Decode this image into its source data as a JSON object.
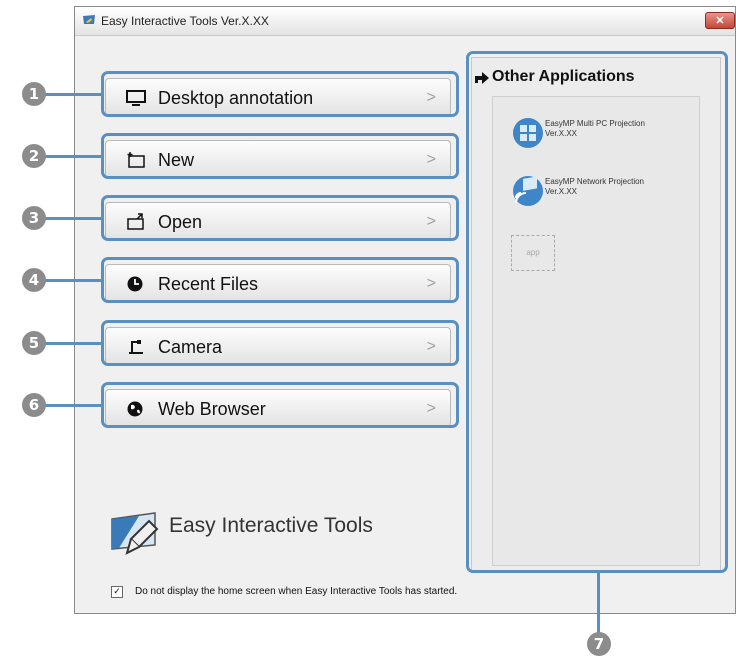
{
  "window": {
    "title": "Easy Interactive Tools Ver.X.XX",
    "close_label": "✕"
  },
  "menu": [
    {
      "label": "Desktop annotation",
      "icon": "monitor-icon"
    },
    {
      "label": "New",
      "icon": "new-whiteboard-icon"
    },
    {
      "label": "Open",
      "icon": "open-folder-icon"
    },
    {
      "label": "Recent Files",
      "icon": "recent-clock-icon"
    },
    {
      "label": "Camera",
      "icon": "document-camera-icon"
    },
    {
      "label": "Web Browser",
      "icon": "globe-icon"
    }
  ],
  "chevron": ">",
  "other_apps": {
    "title": "Other Applications",
    "items": [
      {
        "name": "EasyMP Multi PC Projection",
        "version": "Ver.X.XX"
      },
      {
        "name": "EasyMP Network Projection",
        "version": "Ver.X.XX"
      }
    ],
    "placeholder": "app"
  },
  "logo": {
    "text": "Easy Interactive Tools"
  },
  "startup_checkbox": {
    "checked": true,
    "check_mark": "✓",
    "label": "Do not display the home screen when Easy Interactive Tools has started."
  },
  "callouts": [
    "1",
    "2",
    "3",
    "4",
    "5",
    "6",
    "7"
  ],
  "colors": {
    "callout": "#5a8fc2",
    "badge": "#8c8c8c",
    "close": "#c5463a"
  }
}
